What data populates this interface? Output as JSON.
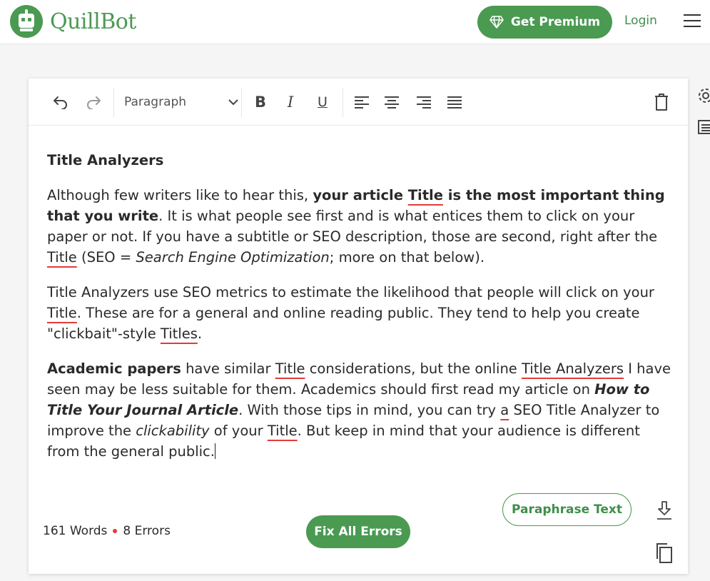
{
  "header": {
    "brand": "QuillBot",
    "premium_label": "Get Premium",
    "login_label": "Login"
  },
  "toolbar": {
    "paragraph_style": "Paragraph",
    "bold_label": "B",
    "italic_label": "I",
    "underline_label": "U"
  },
  "document": {
    "heading": "Title Analyzers",
    "p1": {
      "a": "Although few writers like to hear this, ",
      "b_pre": "your article ",
      "b_err": "Title",
      "b_post": " is the most important thing that you write",
      "c": ". It is what people see first and is what entices them to click on your paper or not. If you have a subtitle or SEO description, those are second, right after the ",
      "err": "Title",
      "d": " (SEO = ",
      "em": "Search Engine Optimization",
      "e": "; more on that below)."
    },
    "p2": {
      "a": "Title Analyzers use SEO metrics to estimate the likelihood that people will click on your ",
      "err1": "Title",
      "b": ". These are for a general and online reading public. They tend to help you create \"clickbait\"-style ",
      "err2": "Titles",
      "c": "."
    },
    "p3": {
      "strong": "Academic papers",
      "a": " have similar ",
      "err1": "Title",
      "b": " considerations, but the online ",
      "err2": "Title Analyzers",
      "c": " I have seen may be less suitable for them. Academics should first read my article on ",
      "bi": "How to Title Your Journal Article",
      "d": ". With those tips in mind, you can try ",
      "err3": "a",
      "e": " SEO Title Analyzer to improve the ",
      "em": "clickability",
      "f": " of your ",
      "err4": "Title",
      "g": ". But keep in mind that your audience is different from the general public."
    }
  },
  "footer": {
    "words": "161 Words",
    "errors": "8 Errors",
    "fix_label": "Fix All Errors",
    "paraphrase_label": "Paraphrase Text"
  },
  "colors": {
    "brand_green": "#4a9a52",
    "error_red": "#e23b3b"
  },
  "icons": [
    "diamond-icon",
    "menu-icon",
    "undo-icon",
    "redo-icon",
    "chevron-down-icon",
    "align-left-icon",
    "align-center-icon",
    "align-right-icon",
    "justify-icon",
    "trash-icon",
    "download-icon",
    "copy-icon",
    "settings-icon",
    "list-icon"
  ]
}
